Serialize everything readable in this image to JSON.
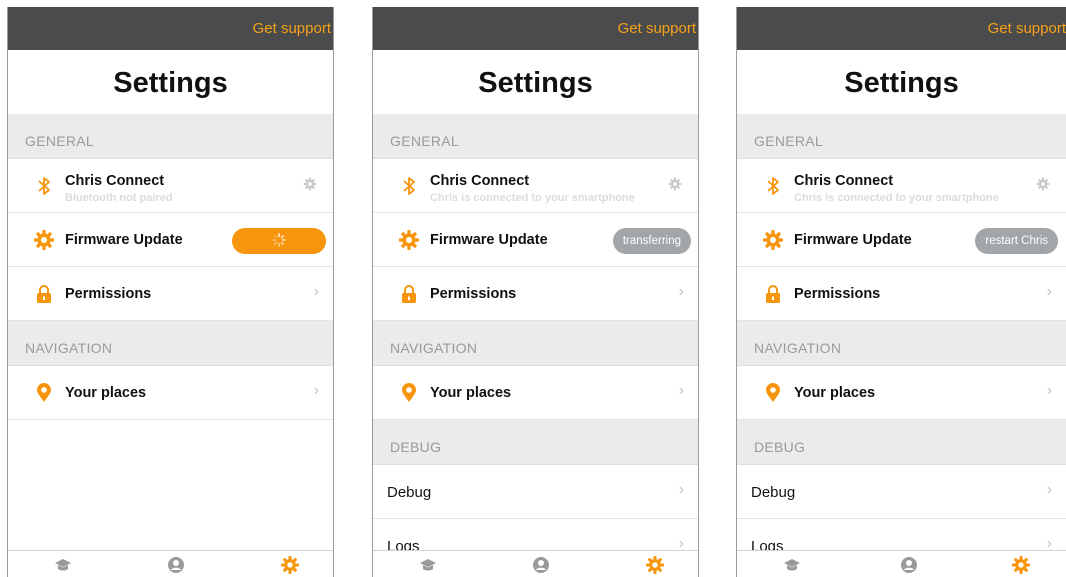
{
  "accent_color": "#f7960e",
  "screens": [
    {
      "support_link": "Get support",
      "title": "Settings",
      "general_header": "GENERAL",
      "chris_connect": {
        "label": "Chris Connect",
        "sublabel": "Bluetooth not paired"
      },
      "firmware": {
        "label": "Firmware Update",
        "status": "",
        "status_icon": "spinner-icon"
      },
      "permissions": {
        "label": "Permissions"
      },
      "navigation_header": "NAVIGATION",
      "places": {
        "label": "Your places"
      },
      "tabs": [
        "graduation-cap-icon",
        "user-icon",
        "gear-icon"
      ],
      "active_tab": 2
    },
    {
      "support_link": "Get support",
      "title": "Settings",
      "general_header": "GENERAL",
      "chris_connect": {
        "label": "Chris Connect",
        "sublabel": "Chris is connected to your smartphone"
      },
      "firmware": {
        "label": "Firmware Update",
        "status": "transferring"
      },
      "permissions": {
        "label": "Permissions"
      },
      "navigation_header": "NAVIGATION",
      "places": {
        "label": "Your places"
      },
      "debug_header": "DEBUG",
      "debug": {
        "label": "Debug"
      },
      "logs": {
        "label": "Logs"
      },
      "tabs": [
        "graduation-cap-icon",
        "user-icon",
        "gear-icon"
      ],
      "active_tab": 2
    },
    {
      "support_link": "Get support",
      "title": "Settings",
      "general_header": "GENERAL",
      "chris_connect": {
        "label": "Chris Connect",
        "sublabel": "Chris is connected to your smartphone"
      },
      "firmware": {
        "label": "Firmware Update",
        "status": "restart Chris"
      },
      "permissions": {
        "label": "Permissions"
      },
      "navigation_header": "NAVIGATION",
      "places": {
        "label": "Your places"
      },
      "debug_header": "DEBUG",
      "debug": {
        "label": "Debug"
      },
      "logs": {
        "label": "Logs"
      },
      "tabs": [
        "graduation-cap-icon",
        "user-icon",
        "gear-icon"
      ],
      "active_tab": 2
    }
  ]
}
